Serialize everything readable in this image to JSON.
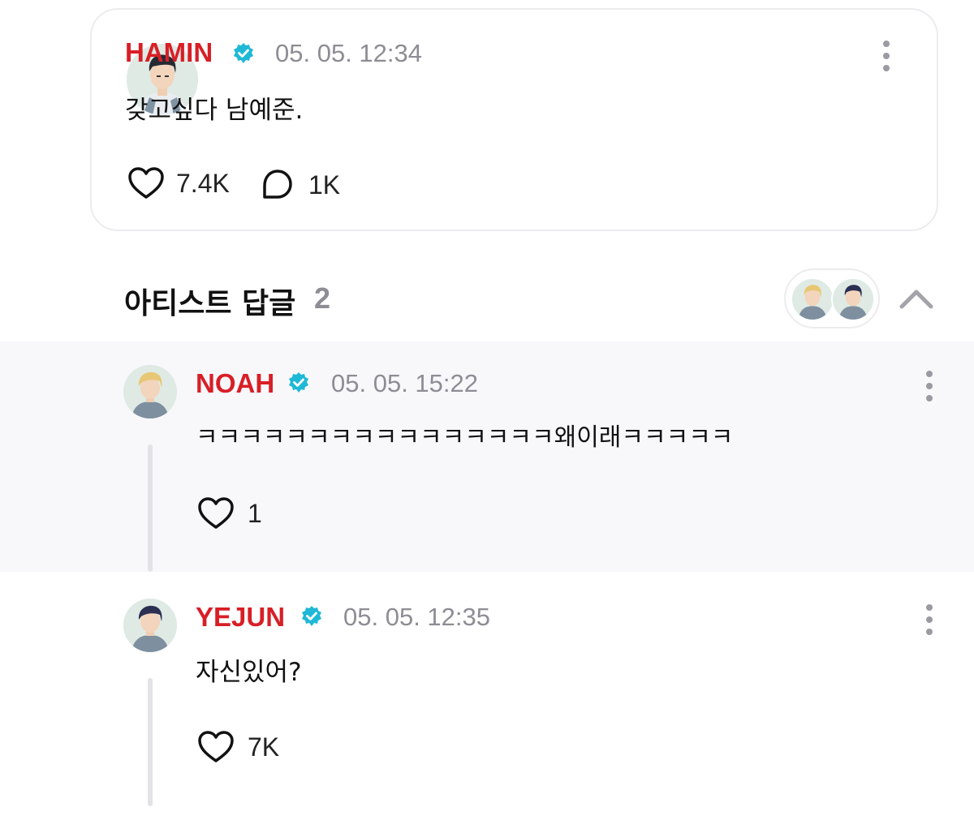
{
  "post": {
    "author": "HAMIN",
    "time": "05. 05. 12:34",
    "text": "갖고싶다 남예준.",
    "likes": "7.4K",
    "comments": "1K"
  },
  "replies_section": {
    "title": "아티스트 답글",
    "count": "2"
  },
  "replies": [
    {
      "author": "NOAH",
      "time": "05. 05. 15:22",
      "text": "ㅋㅋㅋㅋㅋㅋㅋㅋㅋㅋㅋㅋㅋㅋㅋㅋ왜이래ㅋㅋㅋㅋㅋ",
      "likes": "1"
    },
    {
      "author": "YEJUN",
      "time": "05. 05. 12:35",
      "text": "자신있어?",
      "likes": "7K"
    }
  ],
  "colors": {
    "author_name": "#d81f26",
    "verified_badge": "#1fb8d6",
    "timestamp": "#8d8d95",
    "reply_background": "#f8f8fb"
  },
  "icons": [
    "verified-badge-icon",
    "more-vertical-icon",
    "heart-icon",
    "comment-bubble-icon",
    "chevron-up-icon"
  ]
}
